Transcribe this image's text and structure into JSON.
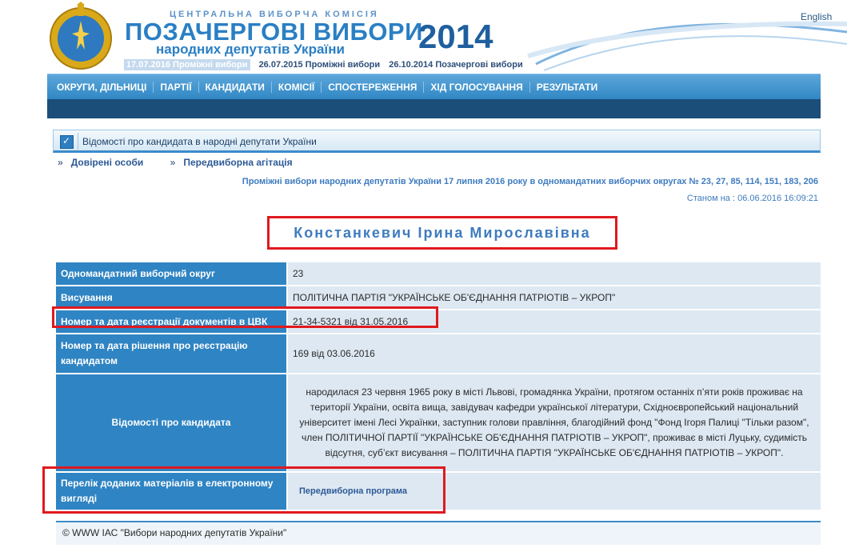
{
  "header": {
    "cvk": "ЦЕНТРАЛЬНА ВИБОРЧА КОМІСІЯ",
    "title": "ПОЗАЧЕРГОВІ ВИБОРИ",
    "subtitle": "народних депутатів України",
    "year": "2014",
    "language_link": "English",
    "election_links": [
      {
        "label": "17.07.2016 Проміжні вибори",
        "active": true
      },
      {
        "label": "26.07.2015 Проміжні вибори",
        "active": false
      },
      {
        "label": "26.10.2014 Позачергові вибори",
        "active": false
      }
    ]
  },
  "nav": {
    "items": [
      "ОКРУГИ, ДІЛЬНИЦІ",
      "ПАРТІЇ",
      "КАНДИДАТИ",
      "КОМІСІЇ",
      "СПОСТЕРЕЖЕННЯ",
      "ХІД ГОЛОСУВАННЯ",
      "РЕЗУЛЬТАТИ"
    ]
  },
  "section": {
    "title": "Відомості про кандидата в народні депутати України",
    "tabs": [
      "Довірені особи",
      "Передвиборна агітація"
    ]
  },
  "election_line": "Проміжні вибори народних депутатів України 17 липня 2016 року в одномандатних виборчих округах № 23, 27, 85, 114, 151, 183, 206",
  "status_label": "Станом на : 06.06.2016 16:09:21",
  "candidate": {
    "name": "Констанкевич Ірина Мирославівна",
    "rows": [
      {
        "label": "Одномандатний виборчий округ",
        "value": "23"
      },
      {
        "label": "Висування",
        "value": "ПОЛІТИЧНА ПАРТІЯ \"УКРАЇНСЬКЕ ОБ'ЄДНАННЯ ПАТРІОТІВ – УКРОП\""
      },
      {
        "label": "Номер та дата реєстрації документів в ЦВК",
        "value": "21-34-5321 від 31.05.2016"
      },
      {
        "label": "Номер та дата рішення про реєстрацію кандидатом",
        "value": "169 від 03.06.2016"
      },
      {
        "label": "Відомості про кандидата",
        "value": "народилася 23 червня 1965 року в місті Львові, громадянка України, протягом останніх п’яти років проживає на території України, освіта вища, завідувач кафедри української літератури, Східноєвропейський національний університет імені Лесі Українки, заступник голови правління, благодійний фонд \"Фонд Ігоря Палиці \"Тільки разом\", член ПОЛІТИЧНОЇ ПАРТІЇ \"УКРАЇНСЬКЕ ОБ'ЄДНАННЯ ПАТРІОТІВ – УКРОП\", проживає в місті Луцьку, судимість відсутня, суб’єкт висування – ПОЛІТИЧНА ПАРТІЯ \"УКРАЇНСЬКЕ ОБ'ЄДНАННЯ ПАТРІОТІВ – УКРОП\"."
      },
      {
        "label": "Перелік доданих матеріалів в електронному вигляді",
        "value": "Передвиборна програма"
      }
    ]
  },
  "footer": "© WWW ІАС \"Вибори народних депутатів України\"",
  "colors": {
    "accent": "#2f84c3",
    "highlight": "#e0191f",
    "nav_dark": "#1b4e78"
  }
}
